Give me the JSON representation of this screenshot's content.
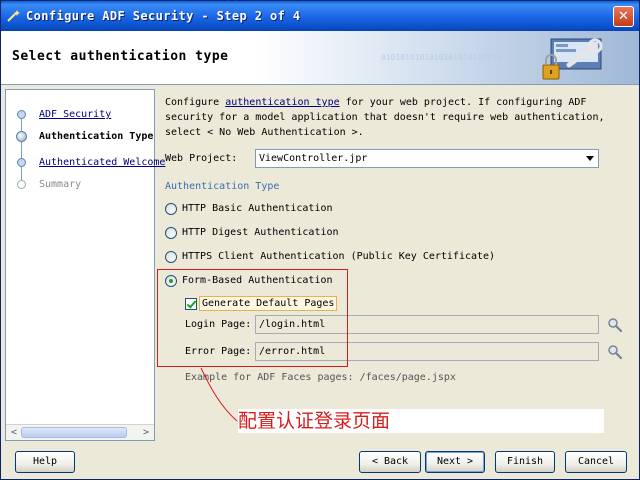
{
  "window": {
    "title": "Configure ADF Security - Step 2 of 4",
    "close_glyph": "✕"
  },
  "header": {
    "title": "Select authentication type",
    "binary_text": "0101010101010101010101010"
  },
  "nav": {
    "items": [
      {
        "label": "ADF Security",
        "state": "link"
      },
      {
        "label": "Authentication Type",
        "state": "current"
      },
      {
        "label": "Authenticated Welcome",
        "state": "link"
      },
      {
        "label": "Summary",
        "state": "disabled"
      }
    ],
    "scroll_left": "<",
    "scroll_right": ">"
  },
  "content": {
    "desc_pre": "Configure ",
    "desc_link": "authentication type",
    "desc_post": " for your web project. If configuring ADF security for a model application that doesn't require web authentication, select < No Web Authentication >.",
    "web_project_label": "Web Project:",
    "web_project_value": "ViewController.jpr",
    "section_title": "Authentication Type",
    "radios": [
      {
        "label": "HTTP Basic Authentication",
        "checked": false
      },
      {
        "label": "HTTP Digest Authentication",
        "checked": false
      },
      {
        "label": "HTTPS Client Authentication (Public Key Certificate)",
        "checked": false
      },
      {
        "label": "Form-Based Authentication",
        "checked": true
      }
    ],
    "generate_label": "Generate Default Pages",
    "generate_checked": true,
    "login_label": "Login Page:",
    "login_value": "/login.html",
    "error_label": "Error Page:",
    "error_value": "/error.html",
    "example": "Example for ADF Faces pages: /faces/page.jspx",
    "annotation": "配置认证登录页面"
  },
  "buttons": {
    "help": "Help",
    "back": "< Back",
    "next": "Next >",
    "finish": "Finish",
    "cancel": "Cancel"
  },
  "colors": {
    "accent": "#3b6eaf",
    "annotation_red": "#d81c1c",
    "titlebar": "#1c68e8"
  }
}
